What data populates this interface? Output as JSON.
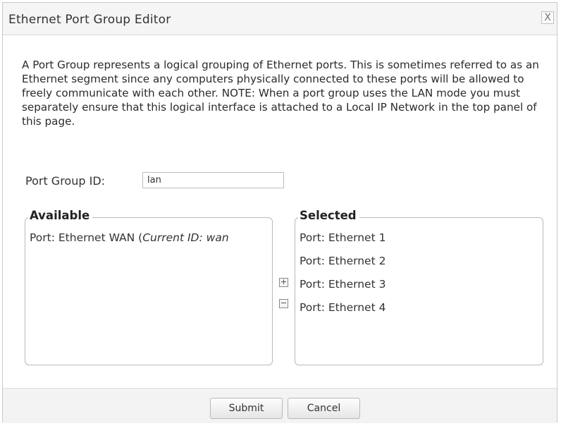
{
  "dialog": {
    "title": "Ethernet Port Group Editor",
    "close_label": "X"
  },
  "description": "A Port Group represents a logical grouping of Ethernet ports. This is sometimes referred to as an Ethernet segment since any computers physically connected to these ports will be allowed to freely communicate with each other. NOTE: When a port group uses the LAN mode you must separately ensure that this logical interface is attached to a Local IP Network in the top panel of this page.",
  "port_group_id": {
    "label": "Port Group ID:",
    "value": "lan"
  },
  "available": {
    "legend": "Available",
    "items": [
      {
        "label": "Port: Ethernet WAN (",
        "italic": "Current ID: wan"
      }
    ]
  },
  "selected": {
    "legend": "Selected",
    "items": [
      {
        "label": "Port: Ethernet 1"
      },
      {
        "label": "Port: Ethernet 2"
      },
      {
        "label": "Port: Ethernet 3"
      },
      {
        "label": "Port: Ethernet 4"
      }
    ]
  },
  "move_buttons": {
    "add": "+",
    "remove": "−"
  },
  "footer": {
    "submit_label": "Submit",
    "cancel_label": "Cancel"
  }
}
